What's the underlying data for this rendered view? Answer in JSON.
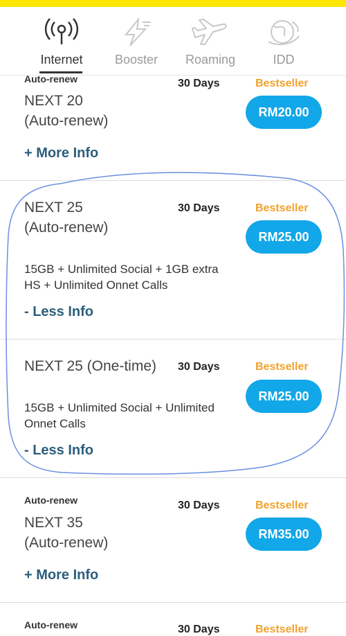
{
  "tabs": [
    {
      "label": "Internet",
      "icon": "signal-icon"
    },
    {
      "label": "Booster",
      "icon": "lightning-icon"
    },
    {
      "label": "Roaming",
      "icon": "airplane-icon"
    },
    {
      "label": "IDD",
      "icon": "globe-phone-icon"
    }
  ],
  "plans": [
    {
      "tag": "Auto-renew",
      "name_line1": "NEXT 20",
      "name_line2": "(Auto-renew)",
      "days": "30 Days",
      "badge": "Bestseller",
      "price": "RM20.00",
      "toggle": "+ More Info"
    },
    {
      "name_line1": "NEXT 25",
      "name_line2": "(Auto-renew)",
      "days": "30 Days",
      "badge": "Bestseller",
      "price": "RM25.00",
      "desc_line1": "15GB + Unlimited Social + 1GB extra",
      "desc_line2": "HS +  Unlimited Onnet Calls",
      "toggle": "- Less Info"
    },
    {
      "name_line1": "NEXT 25 (One-time)",
      "days": "30 Days",
      "badge": "Bestseller",
      "price": "RM25.00",
      "desc_line1": "15GB + Unlimited Social + Unlimited",
      "desc_line2": "Onnet Calls",
      "toggle": "- Less Info"
    },
    {
      "tag": "Auto-renew",
      "name_line1": "NEXT 35",
      "name_line2": "(Auto-renew)",
      "days": "30 Days",
      "badge": "Bestseller",
      "price": "RM35.00",
      "toggle": "+ More Info"
    },
    {
      "tag": "Auto-renew",
      "days": "30 Days",
      "badge": "Bestseller"
    }
  ],
  "colors": {
    "accent_yellow": "#ffe600",
    "price_blue": "#12a7e8",
    "bestseller_orange": "#f2a22c",
    "link_blue": "#2c5e7c",
    "annotation_blue": "#6a8fe0"
  }
}
